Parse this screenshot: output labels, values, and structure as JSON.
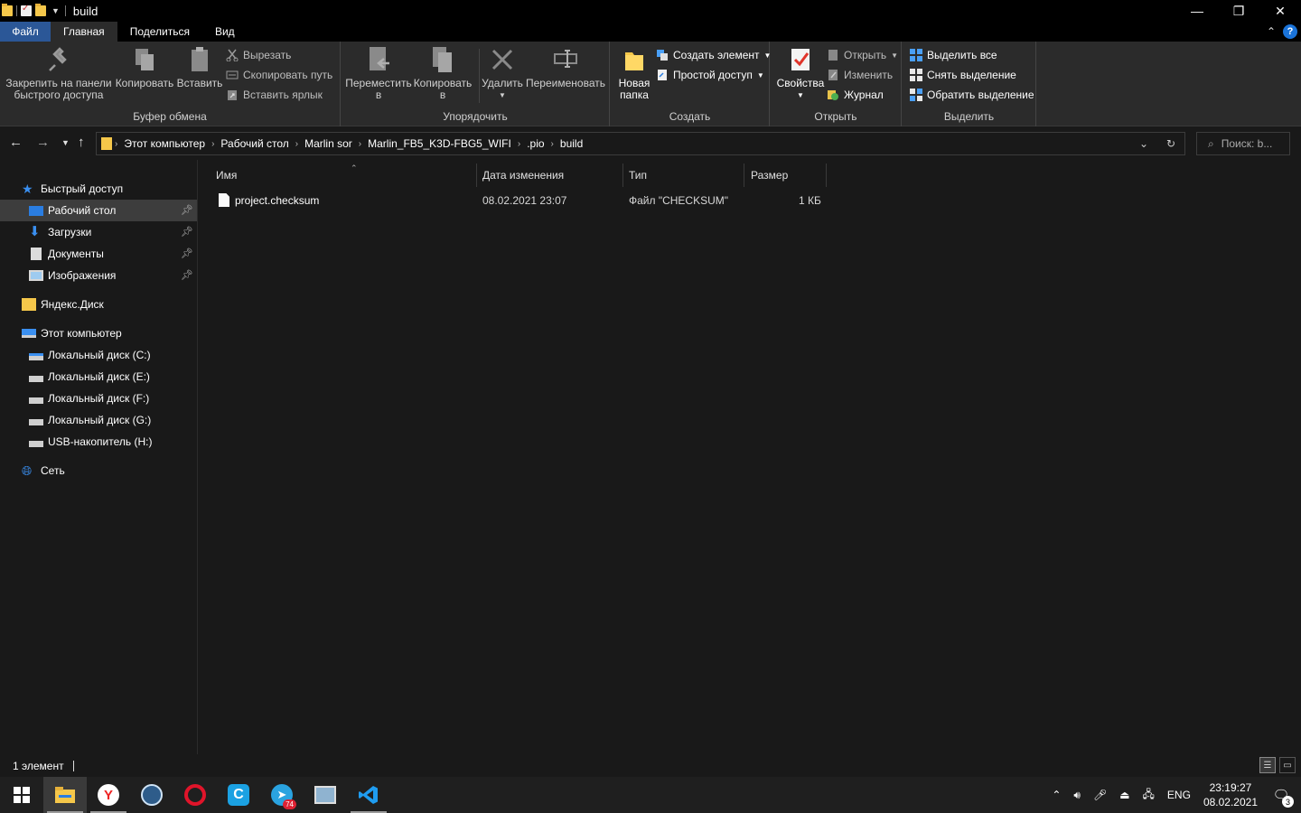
{
  "window": {
    "title": "build",
    "controls": [
      "—",
      "❐",
      "✕"
    ]
  },
  "tabs": {
    "file": "Файл",
    "home": "Главная",
    "share": "Поделиться",
    "view": "Вид",
    "help": "?"
  },
  "ribbon": {
    "clipboard": {
      "label": "Буфер обмена",
      "pin_line1": "Закрепить на панели",
      "pin_line2": "быстрого доступа",
      "copy": "Копировать",
      "paste": "Вставить",
      "cut": "Вырезать",
      "copy_path": "Скопировать путь",
      "paste_shortcut": "Вставить ярлык"
    },
    "organize": {
      "label": "Упорядочить",
      "move_line1": "Переместить",
      "move_line2": "в",
      "copy_line1": "Копировать",
      "copy_line2": "в",
      "delete": "Удалить",
      "rename": "Переименовать"
    },
    "create": {
      "label": "Создать",
      "new_folder_line1": "Новая",
      "new_folder_line2": "папка",
      "new_item": "Создать элемент",
      "easy_access": "Простой доступ"
    },
    "open": {
      "label": "Открыть",
      "properties": "Свойства",
      "open": "Открыть",
      "edit": "Изменить",
      "history": "Журнал"
    },
    "select": {
      "label": "Выделить",
      "select_all": "Выделить все",
      "select_none": "Снять выделение",
      "invert": "Обратить выделение"
    }
  },
  "address": {
    "crumbs": [
      "Этот компьютер",
      "Рабочий стол",
      "Marlin sor",
      "Marlin_FB5_K3D-FBG5_WIFI",
      ".pio",
      "build"
    ],
    "search_placeholder": "Поиск: b..."
  },
  "navpane": {
    "quick_access": "Быстрый доступ",
    "desktop": "Рабочий стол",
    "downloads": "Загрузки",
    "documents": "Документы",
    "pictures": "Изображения",
    "yandex_disk": "Яндекс.Диск",
    "this_pc": "Этот компьютер",
    "drive_c": "Локальный диск (C:)",
    "drive_e": "Локальный диск (E:)",
    "drive_f": "Локальный диск (F:)",
    "drive_g": "Локальный диск (G:)",
    "drive_h": "USB-накопитель (H:)",
    "network": "Сеть"
  },
  "columns": {
    "name": "Имя",
    "date": "Дата изменения",
    "type": "Тип",
    "size": "Размер"
  },
  "files": [
    {
      "name": "project.checksum",
      "date": "08.02.2021 23:07",
      "type": "Файл \"CHECKSUM\"",
      "size": "1 КБ"
    }
  ],
  "status": {
    "count": "1 элемент"
  },
  "taskbar": {
    "telegram_badge": "74",
    "lang": "ENG",
    "time": "23:19:27",
    "date": "08.02.2021",
    "notifications": "3"
  }
}
